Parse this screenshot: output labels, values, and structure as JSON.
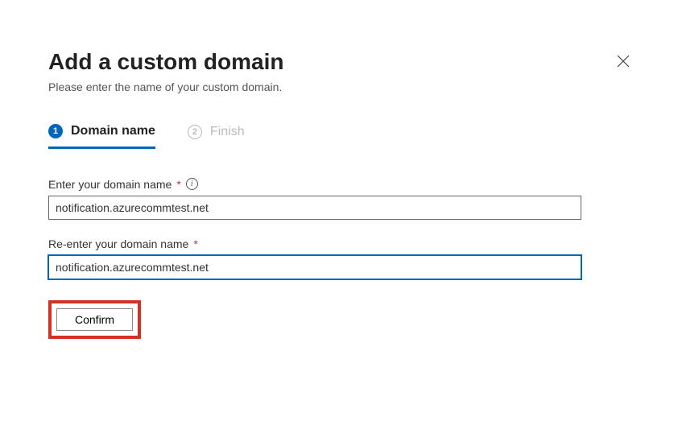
{
  "header": {
    "title": "Add a custom domain",
    "subtitle": "Please enter the name of your custom domain."
  },
  "wizard": {
    "step1": {
      "num": "1",
      "label": "Domain name"
    },
    "step2": {
      "num": "2",
      "label": "Finish"
    }
  },
  "form": {
    "domain_label": "Enter your domain name",
    "domain_value": "notification.azurecommtest.net",
    "reenter_label": "Re-enter your domain name",
    "reenter_value": "notification.azurecommtest.net",
    "confirm_label": "Confirm",
    "required_mark": "*",
    "info_glyph": "i"
  }
}
